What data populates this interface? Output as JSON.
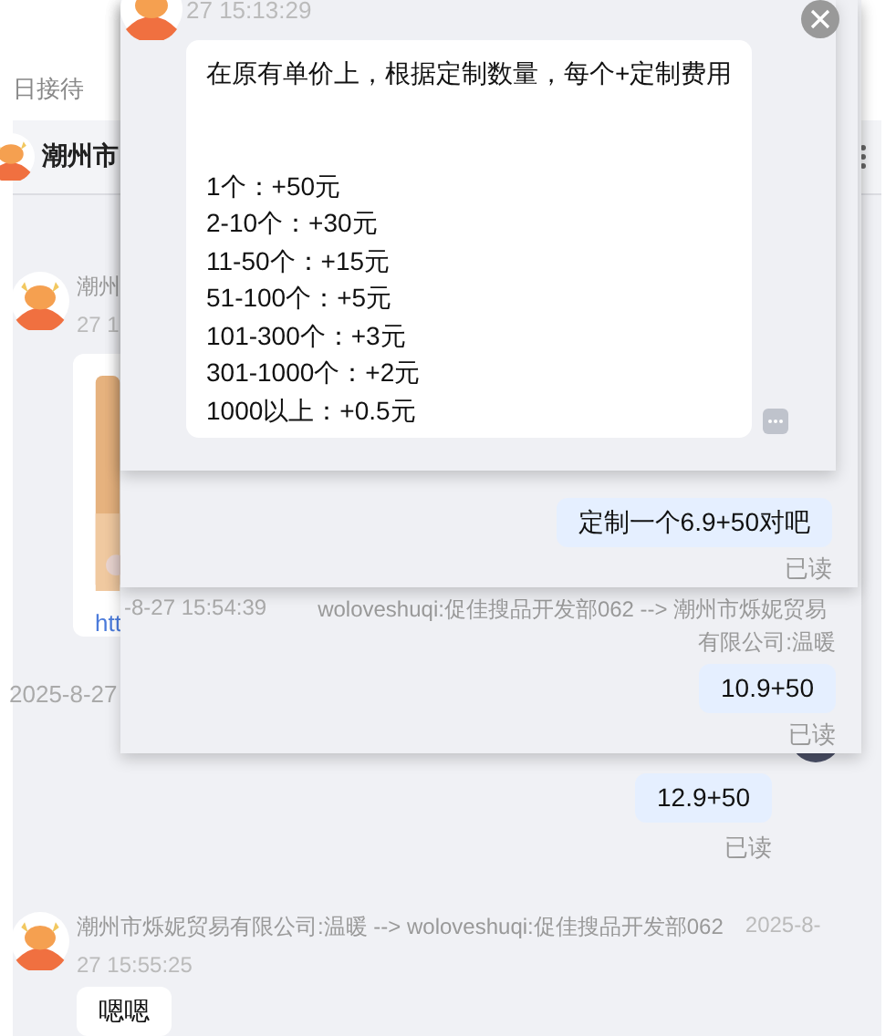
{
  "background": {
    "tab_label": "日接待",
    "header": {
      "title": "潮州市"
    },
    "messages": [
      {
        "kind": "card",
        "sender": "潮州",
        "time": "27 1",
        "link": "htt"
      },
      {
        "kind": "timestamp",
        "text": "2025-8-27"
      },
      {
        "kind": "outgoing",
        "text": "12.9+50",
        "status": "已读"
      },
      {
        "kind": "incoming",
        "sender": "潮州市烁妮贸易有限公司:温暖 --> woloveshuqi:促佳搜品开发部062",
        "date": "2025-8-",
        "time": "27 15:55:25",
        "text": "嗯嗯"
      }
    ]
  },
  "popups": [
    {
      "kind": "detail",
      "time": "27 15:13:29",
      "intro": "在原有单价上，根据定制数量，每个+定制费用",
      "tiers": [
        "1个：+50元",
        "2-10个：+30元",
        "11-50个：+15元",
        "51-100个：+5元",
        "101-300个：+3元",
        "301-1000个：+2元",
        "1000以上：+0.5元"
      ]
    },
    {
      "kind": "chat",
      "text": "定制一个6.9+50对吧",
      "status": "已读"
    },
    {
      "kind": "chat",
      "date": "-8-27 15:54:39",
      "sender": "woloveshuqi:促佳搜品开发部062 --> 潮州市烁妮贸易",
      "sender_tail": "有限公司:温暖",
      "text": "10.9+50",
      "status": "已读"
    }
  ]
}
